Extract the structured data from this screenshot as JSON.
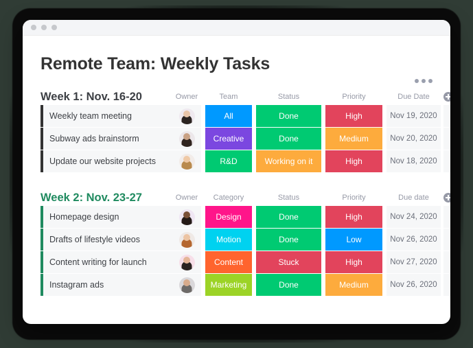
{
  "window": {
    "traffic_lights": [
      "dot-1",
      "dot-2",
      "dot-3"
    ],
    "menu_icon": "kebab-menu-icon"
  },
  "header": {
    "title": "Remote Team: Weekly Tasks"
  },
  "colors": {
    "blue": "#0099FF",
    "green": "#00CA72",
    "red": "#E2445C",
    "orange": "#FDAB3D",
    "purple": "#7B47E0",
    "magenta": "#FF158A",
    "cyan": "#00D2F0",
    "deep_orange": "#FF642E",
    "lime": "#9CD326",
    "row_bar_dark": "#333333",
    "row_bar_green": "#1F8A5F",
    "cell_bg": "#F6F7F8",
    "muted_text": "#9699A6"
  },
  "boards": [
    {
      "title": "Week 1: Nov. 16-20",
      "title_color": "#3C3F44",
      "bar_color": "#333333",
      "columns": [
        "Owner",
        "Team",
        "Status",
        "Priority",
        "Due Date"
      ],
      "add_label": "add-column",
      "rows": [
        {
          "name": "Weekly team meeting",
          "owner": "avatar-woman-dark-hair",
          "tag": {
            "label": "All",
            "color": "#0099FF"
          },
          "status": {
            "label": "Done",
            "color": "#00CA72"
          },
          "priority": {
            "label": "High",
            "color": "#E2445C"
          },
          "due": "Nov 19, 2020"
        },
        {
          "name": "Subway ads brainstorm",
          "owner": "avatar-man-beard",
          "tag": {
            "label": "Creative",
            "color": "#7B47E0"
          },
          "status": {
            "label": "Done",
            "color": "#00CA72"
          },
          "priority": {
            "label": "Medium",
            "color": "#FDAB3D"
          },
          "due": "Nov 20, 2020"
        },
        {
          "name": "Update our website projects",
          "owner": "avatar-woman-blonde",
          "tag": {
            "label": "R&D",
            "color": "#00CA72"
          },
          "status": {
            "label": "Working on it",
            "color": "#FDAB3D"
          },
          "priority": {
            "label": "High",
            "color": "#E2445C"
          },
          "due": "Nov 18, 2020"
        }
      ]
    },
    {
      "title": "Week 2: Nov. 23-27",
      "title_color": "#1F8A5F",
      "bar_color": "#1F8A5F",
      "columns": [
        "Owner",
        "Category",
        "Status",
        "Priority",
        "Due date"
      ],
      "add_label": "add-column",
      "rows": [
        {
          "name": "Homepage design",
          "owner": "avatar-woman-curly-dark",
          "tag": {
            "label": "Design",
            "color": "#FF158A"
          },
          "status": {
            "label": "Done",
            "color": "#00CA72"
          },
          "priority": {
            "label": "High",
            "color": "#E2445C"
          },
          "due": "Nov 24, 2020"
        },
        {
          "name": "Drafts of lifestyle videos",
          "owner": "avatar-woman-ginger",
          "tag": {
            "label": "Motion",
            "color": "#00D2F0"
          },
          "status": {
            "label": "Done",
            "color": "#00CA72"
          },
          "priority": {
            "label": "Low",
            "color": "#0099FF"
          },
          "due": "Nov 26, 2020"
        },
        {
          "name": "Content writing for launch",
          "owner": "avatar-woman-long-hair",
          "tag": {
            "label": "Content",
            "color": "#FF642E"
          },
          "status": {
            "label": "Stuck",
            "color": "#E2445C"
          },
          "priority": {
            "label": "High",
            "color": "#E2445C"
          },
          "due": "Nov 27, 2020"
        },
        {
          "name": "Instagram ads",
          "owner": "avatar-man-gray-beard",
          "tag": {
            "label": "Marketing",
            "color": "#9CD326"
          },
          "status": {
            "label": "Done",
            "color": "#00CA72"
          },
          "priority": {
            "label": "Medium",
            "color": "#FDAB3D"
          },
          "due": "Nov 26, 2020"
        }
      ]
    }
  ]
}
